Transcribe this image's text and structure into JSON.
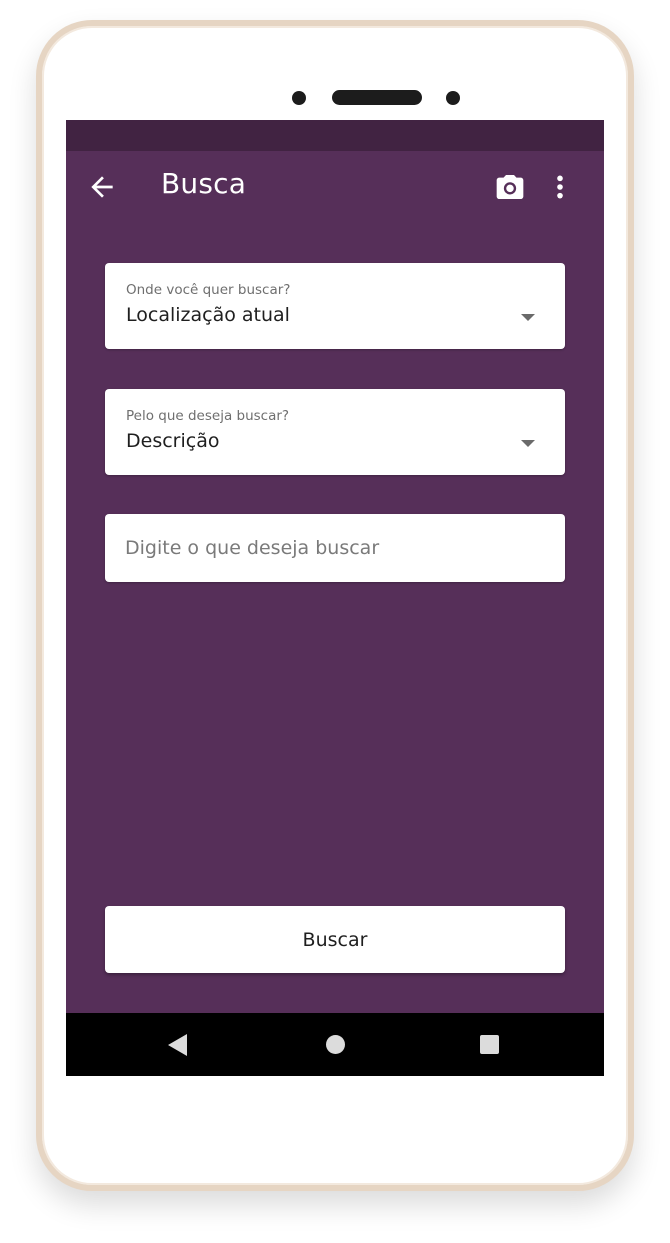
{
  "app": {
    "title": "Busca"
  },
  "toolbar": {
    "back_icon": "arrow-back-icon",
    "camera_icon": "camera-icon",
    "more_icon": "more-vert-icon"
  },
  "form": {
    "location": {
      "label": "Onde você quer buscar?",
      "value": "Localização atual"
    },
    "search_by": {
      "label": "Pelo que deseja buscar?",
      "value": "Descrição"
    },
    "query": {
      "placeholder": "Digite o que deseja buscar",
      "value": ""
    },
    "submit_label": "Buscar"
  },
  "system_nav": {
    "back_icon": "nav-back-icon",
    "home_icon": "nav-home-icon",
    "recent_icon": "nav-recent-apps-icon"
  },
  "colors": {
    "primary": "#562f59",
    "status_bar": "#412342",
    "surface": "#ffffff",
    "nav_bar": "#000000"
  }
}
